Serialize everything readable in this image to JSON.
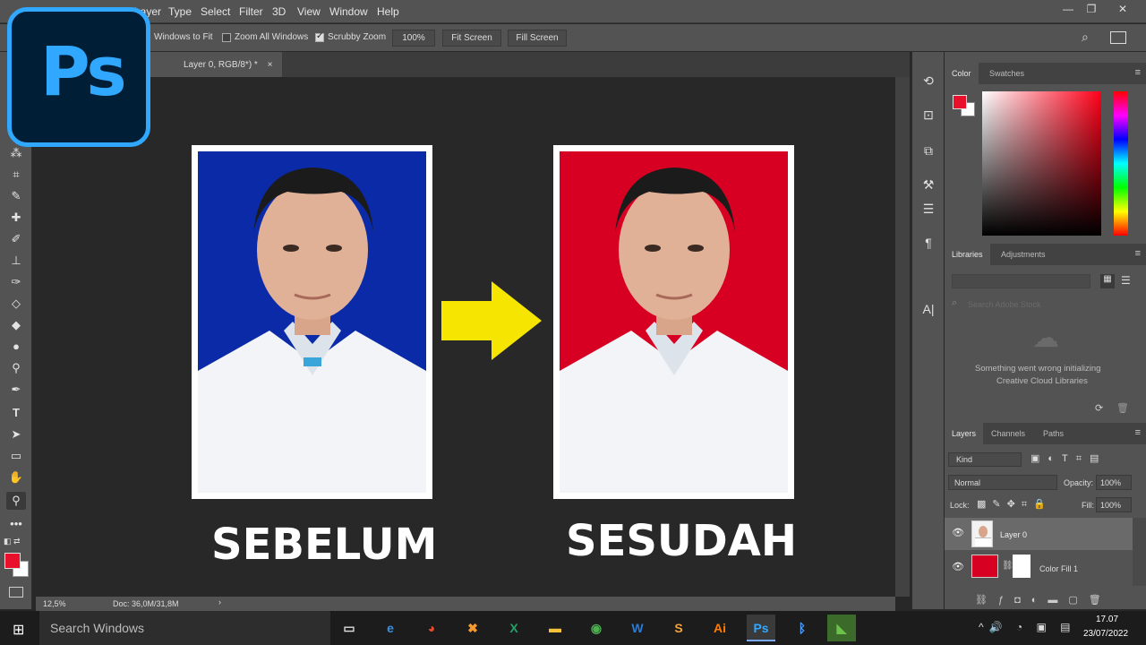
{
  "menu": [
    "Layer",
    "Type",
    "Select",
    "Filter",
    "3D",
    "View",
    "Window",
    "Help"
  ],
  "options": {
    "resize_windows_label": "Windows to Fit",
    "zoom_all_label": "Zoom All Windows",
    "scrubby_zoom_label": "Scrubby Zoom",
    "zoom_value": "100%",
    "fit_screen_label": "Fit Screen",
    "fill_screen_label": "Fill Screen"
  },
  "document": {
    "tab_title": "Layer 0, RGB/8*) *",
    "tab_close": "×"
  },
  "logo": {
    "text": "Ps"
  },
  "canvas": {
    "before_label": "SEBELUM",
    "after_label": "SESUDAH",
    "before_bg_color": "#0a2aa8",
    "after_bg_color": "#d80022",
    "arrow_color": "#f5e500"
  },
  "status": {
    "zoom": "12,5%",
    "doc": "Doc: 36,0M/31,8M"
  },
  "color_panel": {
    "tabs": [
      "Color",
      "Swatches"
    ],
    "foreground_color": "#e8102a",
    "background_color": "#ffffff"
  },
  "libraries_panel": {
    "tabs": [
      "Libraries",
      "Adjustments"
    ],
    "search_placeholder": "Search Adobe Stock",
    "error_line1": "Something went wrong initializing",
    "error_line2": "Creative Cloud Libraries"
  },
  "layers_panel": {
    "tabs": [
      "Layers",
      "Channels",
      "Paths"
    ],
    "filter_kind": "Kind",
    "blend_mode": "Normal",
    "opacity_label": "Opacity:",
    "opacity_value": "100%",
    "lock_label": "Lock:",
    "fill_label": "Fill:",
    "fill_value": "100%",
    "layers": [
      {
        "name": "Layer 0"
      },
      {
        "name": "Color Fill 1"
      }
    ]
  },
  "taskbar": {
    "search_placeholder": "Search Windows",
    "time": "17.07",
    "date": "23/07/2022"
  }
}
